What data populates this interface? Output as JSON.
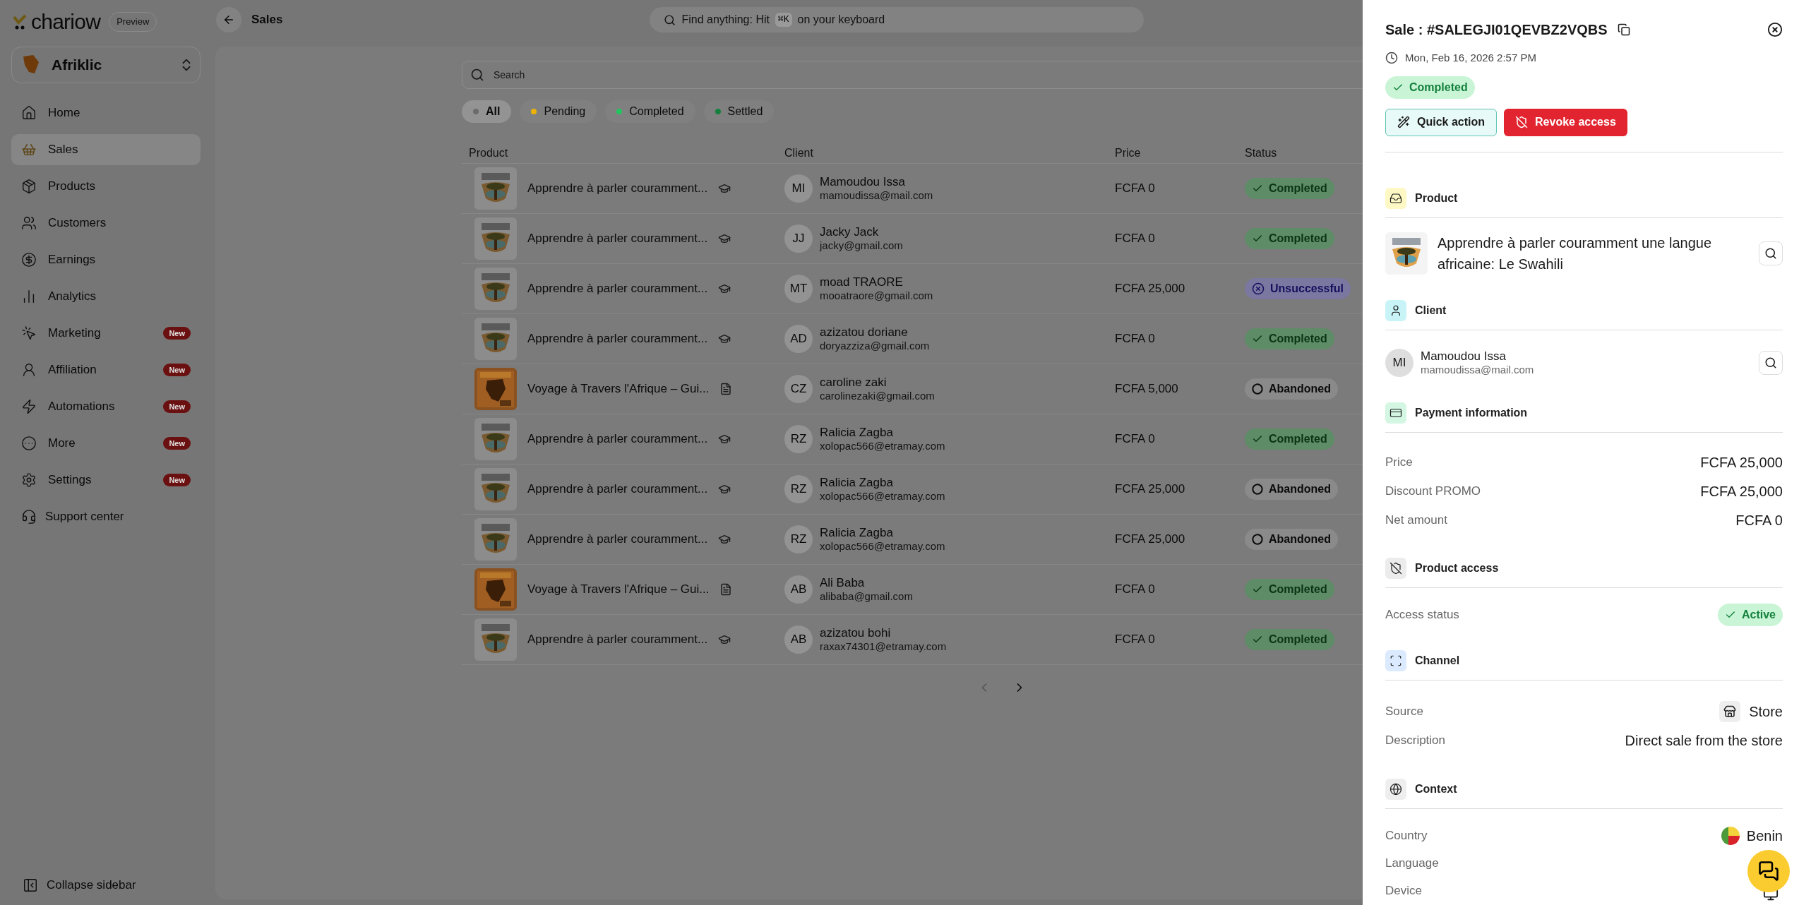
{
  "brand": {
    "name": "chariow",
    "tag": "Preview"
  },
  "workspace": {
    "name": "Afriklic"
  },
  "sidebar": {
    "items": [
      {
        "label": "Home",
        "selected": false
      },
      {
        "label": "Sales",
        "selected": true
      },
      {
        "label": "Products",
        "selected": false
      },
      {
        "label": "Customers",
        "selected": false
      },
      {
        "label": "Earnings",
        "selected": false
      },
      {
        "label": "Analytics",
        "selected": false
      },
      {
        "label": "Marketing",
        "selected": false,
        "badge": "New"
      },
      {
        "label": "Affiliation",
        "selected": false,
        "badge": "New"
      },
      {
        "label": "Automations",
        "selected": false,
        "badge": "New"
      },
      {
        "label": "More",
        "selected": false,
        "badge": "New"
      },
      {
        "label": "Settings",
        "selected": false,
        "badge": "New"
      }
    ],
    "support": "Support center",
    "collapse": "Collapse sidebar"
  },
  "topbar": {
    "title": "Sales",
    "search": {
      "prefix": "Find anything: Hit",
      "shortcut": "⌘K",
      "suffix": "on your keyboard"
    }
  },
  "search": {
    "placeholder": "Search"
  },
  "filters": [
    {
      "label": "All",
      "selected": true,
      "color": "#6b6b6b"
    },
    {
      "label": "Pending",
      "selected": false,
      "color": "#eab308"
    },
    {
      "label": "Completed",
      "selected": false,
      "color": "#22c55e"
    },
    {
      "label": "Settled",
      "selected": false,
      "color": "#15803d"
    }
  ],
  "table": {
    "columns": [
      "Product",
      "Client",
      "Price",
      "Status"
    ],
    "rows": [
      {
        "product": "Apprendre à parler couramment...",
        "kind": "course",
        "initials": "MI",
        "client": "Mamoudou Issa",
        "email": "mamoudissa@mail.com",
        "price": "FCFA 0",
        "status": {
          "label": "Completed",
          "kind": "completed"
        }
      },
      {
        "product": "Apprendre à parler couramment...",
        "kind": "course",
        "initials": "JJ",
        "client": "Jacky Jack",
        "email": "jacky@gmail.com",
        "price": "FCFA 0",
        "status": {
          "label": "Completed",
          "kind": "completed"
        }
      },
      {
        "product": "Apprendre à parler couramment...",
        "kind": "course",
        "initials": "MT",
        "client": "moad TRAORE",
        "email": "mooatraore@gmail.com",
        "price": "FCFA 25,000",
        "status": {
          "label": "Unsuccessful",
          "kind": "failed"
        }
      },
      {
        "product": "Apprendre à parler couramment...",
        "kind": "course",
        "initials": "AD",
        "client": "azizatou doriane",
        "email": "doryazziza@gmail.com",
        "price": "FCFA 0",
        "status": {
          "label": "Completed",
          "kind": "completed"
        }
      },
      {
        "product": "Voyage à Travers l'Afrique – Gui...",
        "kind": "ebook",
        "initials": "CZ",
        "client": "caroline zaki",
        "email": "carolinezaki@gmail.com",
        "price": "FCFA 5,000",
        "status": {
          "label": "Abandoned",
          "kind": "abandoned"
        }
      },
      {
        "product": "Apprendre à parler couramment...",
        "kind": "course",
        "initials": "RZ",
        "client": "Ralicia Zagba",
        "email": "xolopac566@etramay.com",
        "price": "FCFA 0",
        "status": {
          "label": "Completed",
          "kind": "completed"
        }
      },
      {
        "product": "Apprendre à parler couramment...",
        "kind": "course",
        "initials": "RZ",
        "client": "Ralicia Zagba",
        "email": "xolopac566@etramay.com",
        "price": "FCFA 25,000",
        "status": {
          "label": "Abandoned",
          "kind": "abandoned"
        }
      },
      {
        "product": "Apprendre à parler couramment...",
        "kind": "course",
        "initials": "RZ",
        "client": "Ralicia Zagba",
        "email": "xolopac566@etramay.com",
        "price": "FCFA 25,000",
        "status": {
          "label": "Abandoned",
          "kind": "abandoned"
        }
      },
      {
        "product": "Voyage à Travers l'Afrique – Gui...",
        "kind": "ebook",
        "initials": "AB",
        "client": "Ali Baba",
        "email": "alibaba@gmail.com",
        "price": "FCFA 0",
        "status": {
          "label": "Completed",
          "kind": "completed"
        }
      },
      {
        "product": "Apprendre à parler couramment...",
        "kind": "course",
        "initials": "AB",
        "client": "azizatou bohi",
        "email": "raxax74301@etramay.com",
        "price": "FCFA 0",
        "status": {
          "label": "Completed",
          "kind": "completed"
        }
      }
    ]
  },
  "panel": {
    "title": "Sale : #SALEGJI01QEVBZ2VQBS",
    "date": "Mon, Feb 16, 2026 2:57 PM",
    "status": "Completed",
    "actions": [
      {
        "label": "Quick action",
        "kind": "quick"
      },
      {
        "label": "Revoke access",
        "kind": "revoke"
      }
    ],
    "product": {
      "heading": "Product",
      "name": "Apprendre à parler couramment une langue africaine: Le Swahili"
    },
    "client": {
      "heading": "Client",
      "initials": "MI",
      "name": "Mamoudou Issa",
      "email": "mamoudissa@mail.com"
    },
    "payment": {
      "heading": "Payment information",
      "rows": [
        {
          "label": "Price",
          "value": "FCFA 25,000"
        },
        {
          "label": "Discount PROMO",
          "value": "FCFA 25,000"
        },
        {
          "label": "Net amount",
          "value": "FCFA 0"
        }
      ]
    },
    "access": {
      "heading": "Product access",
      "label": "Access status",
      "value": "Active"
    },
    "channel": {
      "heading": "Channel",
      "rows": [
        {
          "label": "Source",
          "value": "Store",
          "kind": "store"
        },
        {
          "label": "Description",
          "value": "Direct sale from the store",
          "kind": "text"
        }
      ]
    },
    "context": {
      "heading": "Context",
      "rows": [
        {
          "label": "Country",
          "value": "Benin",
          "kind": "flag"
        },
        {
          "label": "Language",
          "kind": "hidden"
        },
        {
          "label": "Device",
          "kind": "device"
        }
      ]
    }
  }
}
